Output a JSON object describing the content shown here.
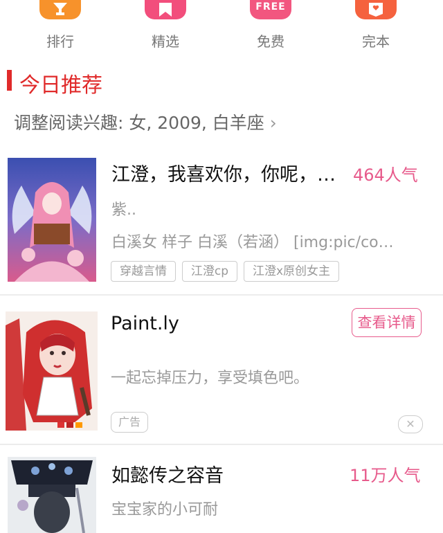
{
  "nav": {
    "items": [
      {
        "label": "排行",
        "icon": "trophy-icon",
        "color": "#f7922b"
      },
      {
        "label": "精选",
        "icon": "star-bookmark-icon",
        "color": "#f24e7c"
      },
      {
        "label": "免费",
        "icon": "free-icon",
        "icon_text": "FREE",
        "color": "#f2567f"
      },
      {
        "label": "完本",
        "icon": "heart-book-icon",
        "color": "#f5623e"
      }
    ]
  },
  "section": {
    "title": "今日推荐"
  },
  "interest": {
    "text": "调整阅读兴趣: 女, 2009, 白羊座",
    "chevron": "›"
  },
  "books": [
    {
      "title": "江澄，我喜欢你，你呢，…",
      "popularity": "464人气",
      "subtitle": "紫..",
      "authors": "白溪女 样子 白溪（若涵） [img:pic/co…",
      "tags": [
        "穿越言情",
        "江澄cp",
        "江澄x原创女主"
      ]
    }
  ],
  "ad": {
    "title": "Paint.ly",
    "button": "查看详情",
    "description": "一起忘掉压力，享受填色吧。",
    "badge": "广告",
    "close": "✕"
  },
  "book2": {
    "title": "如懿传之容音",
    "popularity": "11万人气",
    "subtitle": "宝宝家的小可耐"
  },
  "colors": {
    "accent_red": "#e02a2a",
    "pink": "#e75a8b"
  }
}
